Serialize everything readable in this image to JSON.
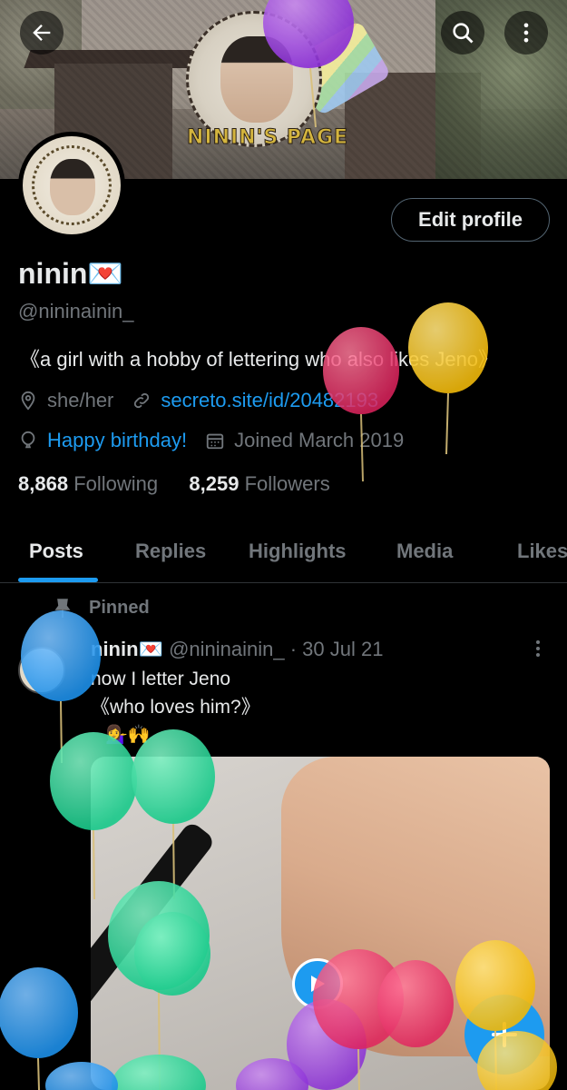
{
  "header": {
    "back_icon": "arrow-left-icon",
    "search_icon": "search-icon",
    "more_icon": "more-vertical-icon",
    "banner_text": "NININ'S PAGE"
  },
  "profile": {
    "edit_label": "Edit profile",
    "name": "ninin💌",
    "handle": "@nininainin_",
    "bio": "《a girl with a hobby of lettering who also likes Jeno》",
    "pronouns": "she/her",
    "website": "secreto.site/id/20482193",
    "birthday": "Happy birthday!",
    "joined": "Joined March 2019",
    "following_count": "8,868",
    "following_label": "Following",
    "followers_count": "8,259",
    "followers_label": "Followers"
  },
  "tabs": [
    {
      "label": "Posts"
    },
    {
      "label": "Replies"
    },
    {
      "label": "Highlights"
    },
    {
      "label": "Media"
    },
    {
      "label": "Likes"
    }
  ],
  "post": {
    "pinned_label": "Pinned",
    "author_name": "ninin💌",
    "author_meta": "@nininainin_ · 30 Jul 21",
    "text": "now I letter Jeno\n《who loves him?》",
    "emoji": "💁‍♀️🙌"
  },
  "colors": {
    "accent": "#1d9bf0",
    "muted": "#71767b",
    "text": "#e7e9ea"
  }
}
